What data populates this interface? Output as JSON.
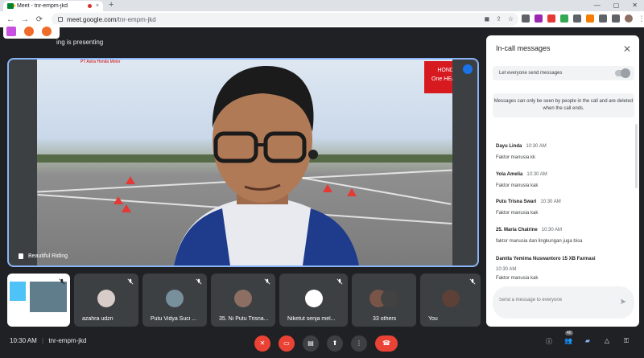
{
  "browser": {
    "tab_title": "Meet - tnr-empm-jkd",
    "tab_close": "×",
    "new_tab": "+",
    "url_host": "meet.google.com",
    "url_path": "/tnr-empm-jkd",
    "nav": {
      "back": "←",
      "forward": "→",
      "reload": "⟳"
    },
    "window": {
      "minimize": "—",
      "maximize": "▢",
      "close": "✕"
    }
  },
  "meet": {
    "presenting_text": "ing is presenting",
    "main_tile_name": "Beautiful Riding",
    "sponsor_text": "PT Astra Honda Motor",
    "honda_logo_top": "HONDA",
    "honda_logo_bottom": "One HEART.",
    "thumbnails": [
      {
        "name": "",
        "kind": "screen"
      },
      {
        "name": "azahra udzri",
        "kind": "avatar",
        "color": "#d7ccc8"
      },
      {
        "name": "Putu Vidya Suci ...",
        "kind": "avatar",
        "color": "#78909c"
      },
      {
        "name": "35. Ni Putu Trisna...",
        "kind": "avatar",
        "color": "#8d6e63"
      },
      {
        "name": "Niketut senja mel...",
        "kind": "avatar",
        "color": "#ffffff"
      },
      {
        "name": "33 others",
        "kind": "group"
      },
      {
        "name": "You",
        "kind": "avatar",
        "color": "#5d4037"
      }
    ],
    "meeting_time": "10:30 AM",
    "meeting_code": "tnr-empm-jkd",
    "participants_count": "40"
  },
  "chat": {
    "title": "In-call messages",
    "close": "✕",
    "toggle_label": "Let everyone send messages",
    "notice": "Messages can only be seen by people in the call and are deleted when the call ends.",
    "messages": [
      {
        "sender": "Dayu Linda",
        "time": "10:30 AM",
        "text": "Faktor manusia kk"
      },
      {
        "sender": "Yola Amelia",
        "time": "10:30 AM",
        "text": "Faktor manusia kak"
      },
      {
        "sender": "Putu Trisna Swari",
        "time": "10:30 AM",
        "text": "Faktor manusia kak"
      },
      {
        "sender": "25. Maria Chatrine",
        "time": "10:30 AM",
        "text": "faktor manusia dan lingkungan juga bisa"
      },
      {
        "sender": "Damita Yemima Nuswantoro 15 XB Farmasi",
        "time": "10:30 AM",
        "text": "Faktor manusia kak"
      }
    ],
    "input_placeholder": "Send a message to everyone",
    "send": "➤"
  }
}
